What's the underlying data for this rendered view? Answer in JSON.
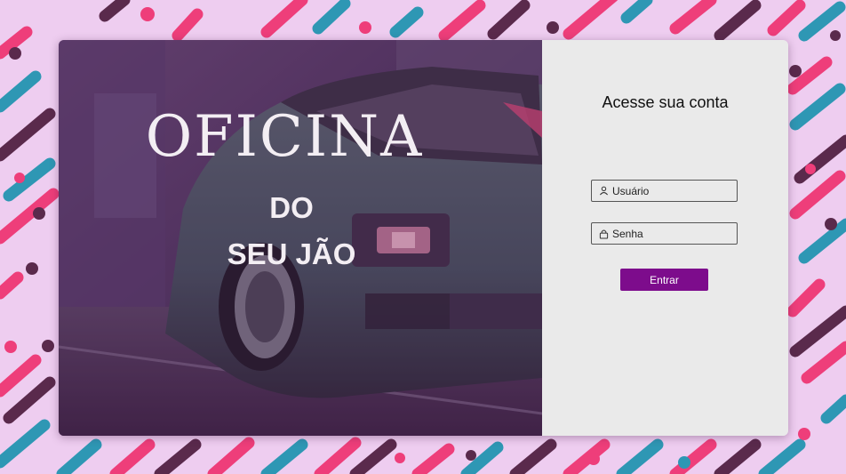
{
  "hero": {
    "title_line1": "OFICINA",
    "title_line2": "DO",
    "title_line3": "SEU JÃO",
    "image": "sports-car-photo"
  },
  "login": {
    "heading": "Acesse sua conta",
    "username_placeholder": "Usuário",
    "username_icon": "user-icon",
    "password_placeholder": "Senha",
    "password_icon": "lock-icon",
    "submit_label": "Entrar"
  },
  "colors": {
    "background": "#eecdf0",
    "stripe_pink": "#ee3e7a",
    "stripe_teal": "#2e97b4",
    "stripe_plum": "#5a2a4c",
    "panel": "#eaeaea",
    "button": "#7d0c8c",
    "hero_tint": "#4a2150"
  }
}
